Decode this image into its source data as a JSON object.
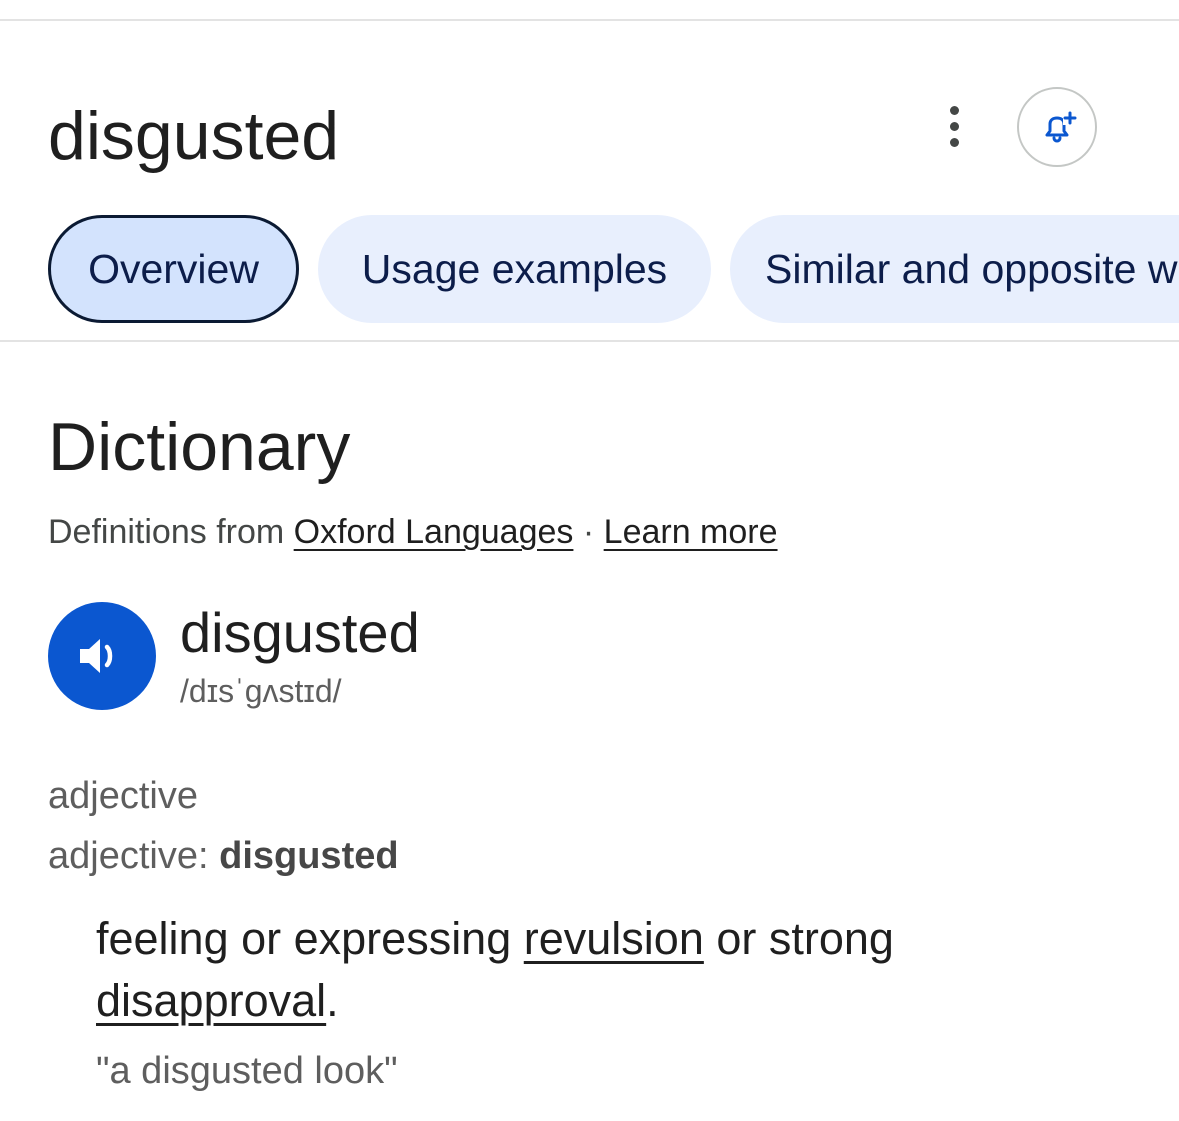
{
  "query": {
    "title": "disgusted"
  },
  "header": {
    "more_icon": "more-vert-icon",
    "alert_icon": "bell-plus-icon",
    "accent_color": "#0b57d0"
  },
  "tabs": [
    {
      "label": "Overview",
      "active": true
    },
    {
      "label": "Usage examples",
      "active": false
    },
    {
      "label": "Similar and opposite w",
      "active": false
    }
  ],
  "dictionary": {
    "section_title": "Dictionary",
    "source_prefix": "Definitions from",
    "source_link": "Oxford Languages",
    "separator": "·",
    "learn_more": "Learn more",
    "speaker_icon": "volume-icon",
    "headword": "disgusted",
    "phonetic": "/dɪsˈɡʌstɪd/",
    "part_of_speech": "adjective",
    "form_label": "adjective:",
    "form_word": "disgusted",
    "definition": {
      "part1": "feeling or expressing",
      "link1": "revulsion",
      "part2": "or strong",
      "link2": "disapproval",
      "end": "."
    },
    "example": "\"a disgusted look\""
  }
}
